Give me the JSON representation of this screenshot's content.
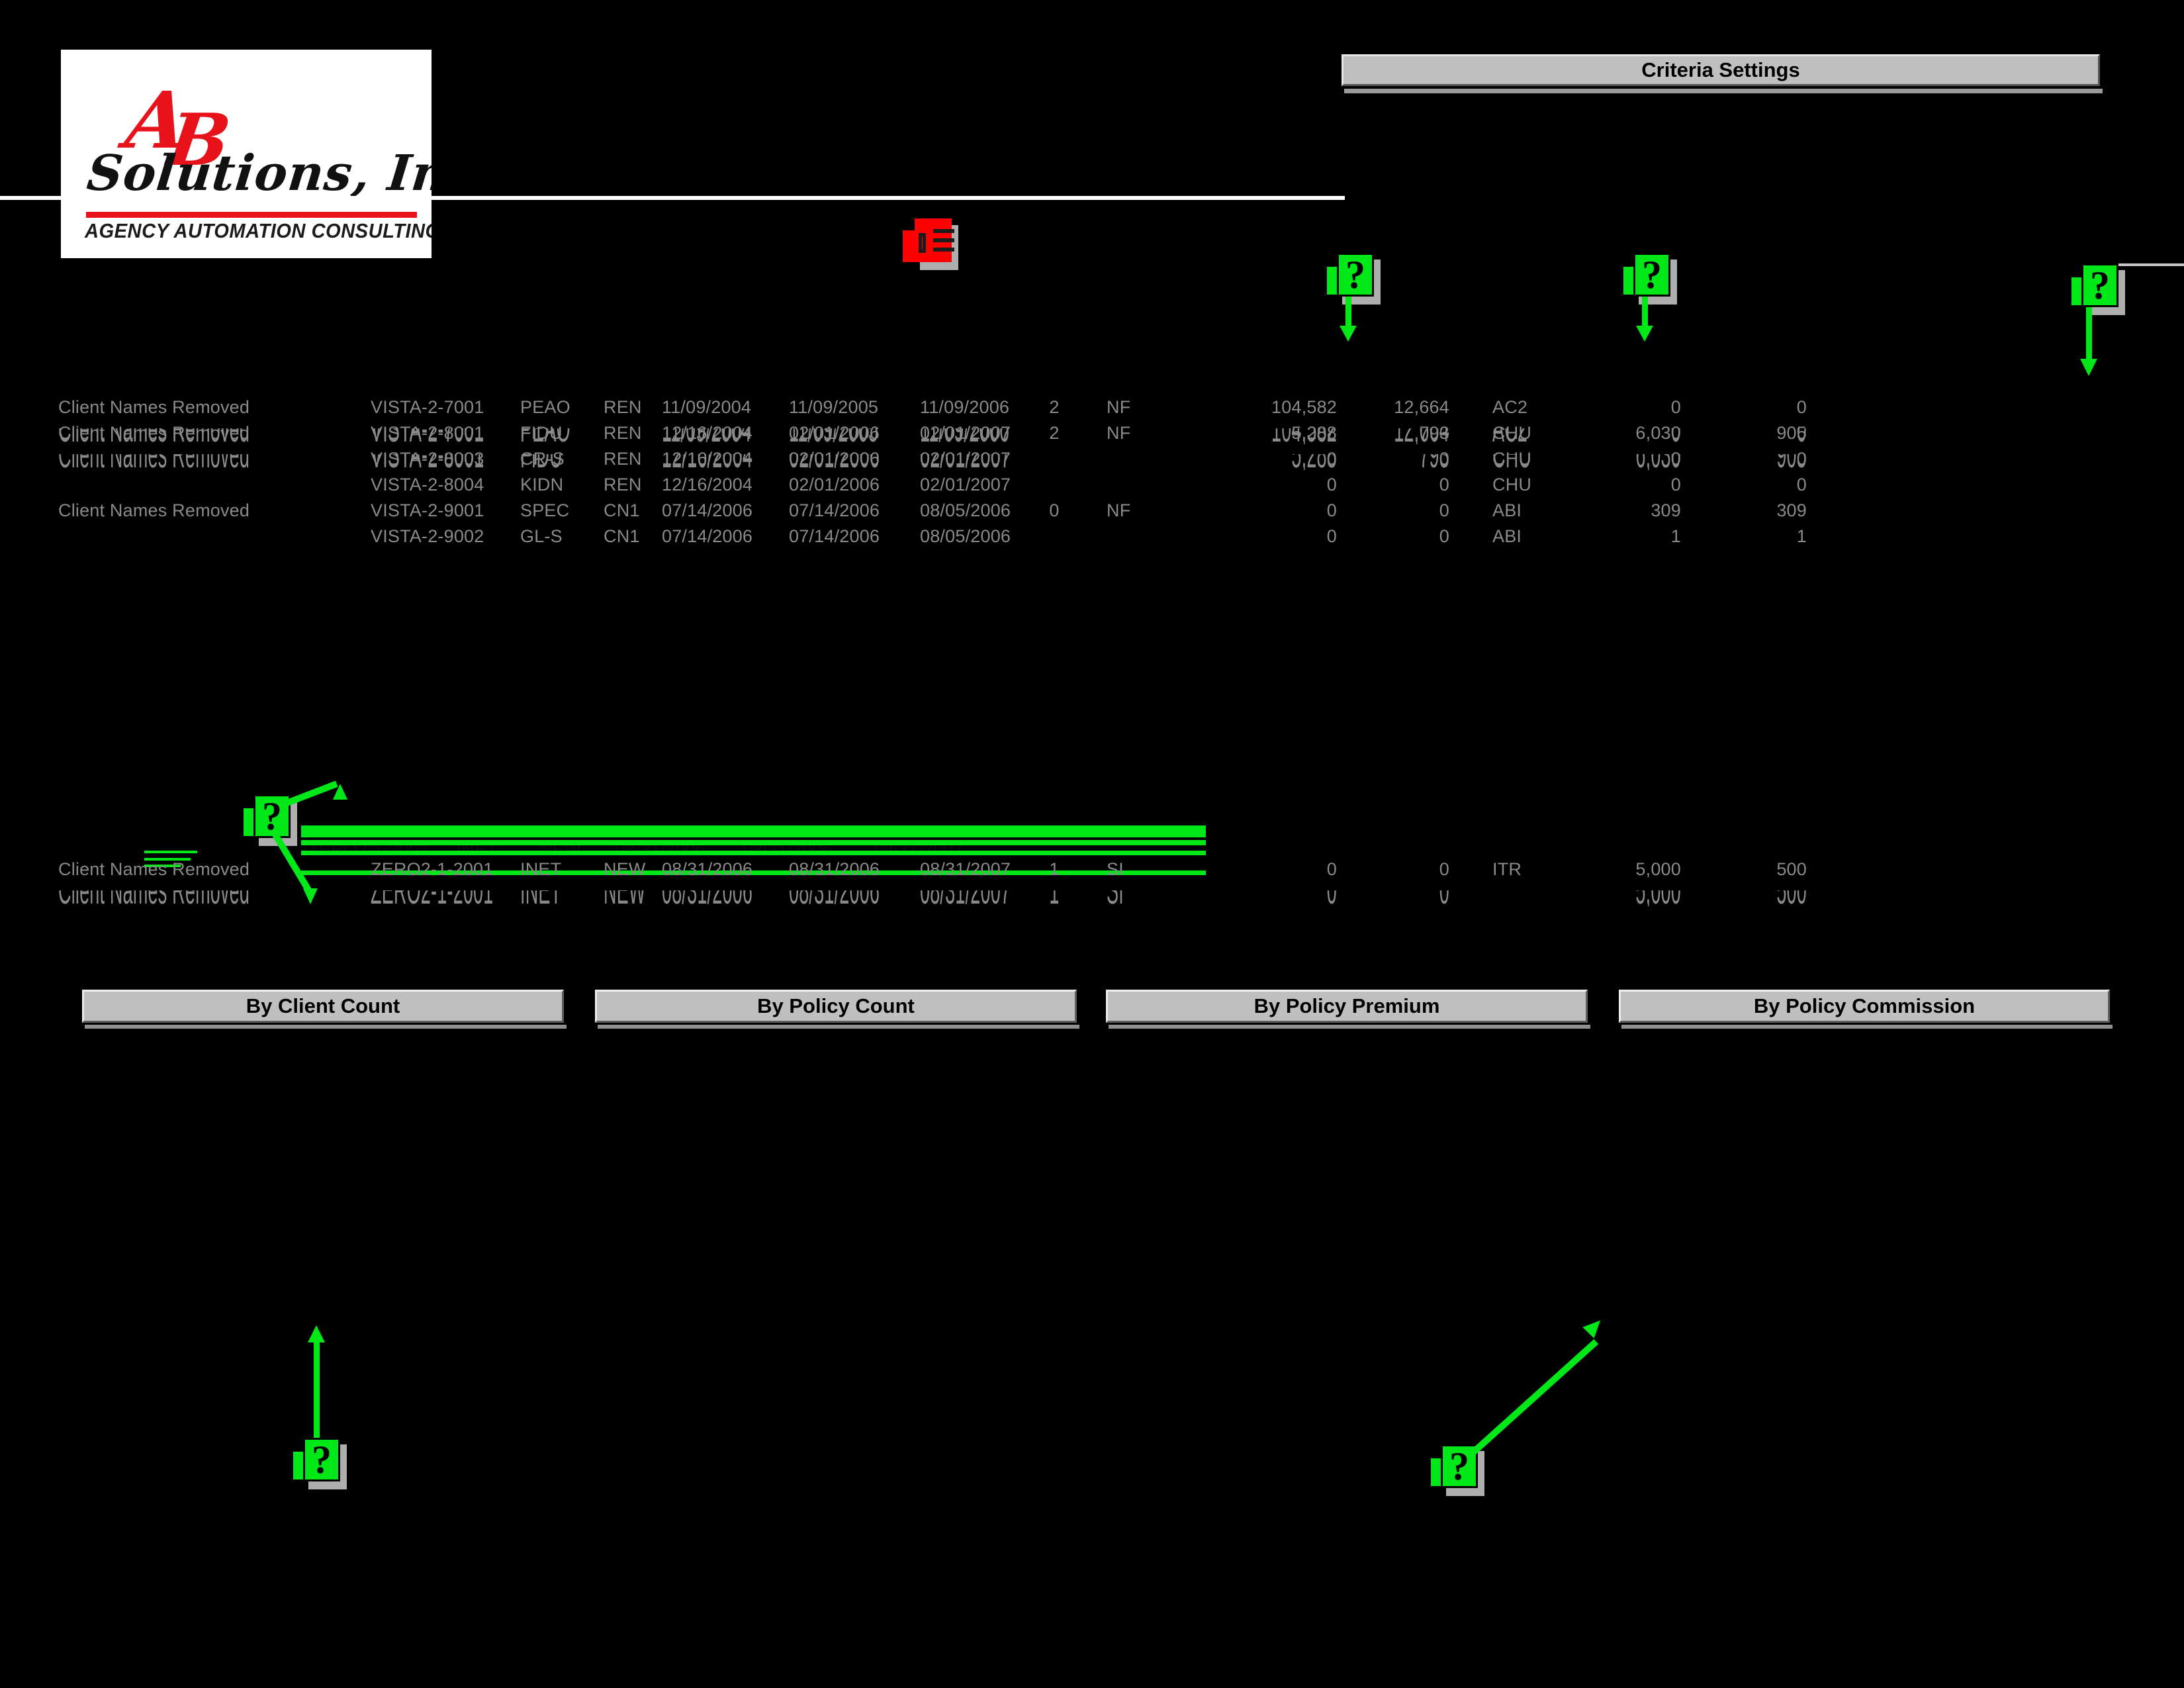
{
  "logo": {
    "initials": "AB",
    "initial_a": "A",
    "initial_b": "B",
    "company": "Solutions, Inc.",
    "tagline": "AGENCY AUTOMATION CONSULTING"
  },
  "header": {
    "criteria_settings_label": "Criteria Settings"
  },
  "table": {
    "rows": [
      {
        "client": "Client Names Removed",
        "policy": "VISTA-2-7001",
        "line": "PEAO",
        "type": "REN",
        "eff_date": "11/09/2004",
        "exp_date": "11/09/2005",
        "renew_date": "11/09/2006",
        "count": "2",
        "status": "NF",
        "premium": "104,582",
        "commission": "12,664",
        "code": "AC2",
        "value1": "0",
        "value2": "0"
      },
      {
        "client": "Client Names Removed",
        "policy": "VISTA-2-8001",
        "line": "FIDU",
        "type": "REN",
        "eff_date": "12/16/2004",
        "exp_date": "02/01/2006",
        "renew_date": "02/01/2007",
        "count": "2",
        "status": "NF",
        "premium": "5,288",
        "commission": "793",
        "code": "CHU",
        "value1": "6,030",
        "value2": "905"
      },
      {
        "client": "",
        "policy": "VISTA-2-8003",
        "line": "CR-S",
        "type": "REN",
        "eff_date": "12/16/2004",
        "exp_date": "02/01/2006",
        "renew_date": "02/01/2007",
        "count": "",
        "status": "",
        "premium": "0",
        "commission": "0",
        "code": "CHU",
        "value1": "0",
        "value2": "0"
      },
      {
        "client": "",
        "policy": "VISTA-2-8004",
        "line": "KIDN",
        "type": "REN",
        "eff_date": "12/16/2004",
        "exp_date": "02/01/2006",
        "renew_date": "02/01/2007",
        "count": "",
        "status": "",
        "premium": "0",
        "commission": "0",
        "code": "CHU",
        "value1": "0",
        "value2": "0"
      },
      {
        "client": "Client Names Removed",
        "policy": "VISTA-2-9001",
        "line": "SPEC",
        "type": "CN1",
        "eff_date": "07/14/2006",
        "exp_date": "07/14/2006",
        "renew_date": "08/05/2006",
        "count": "0",
        "status": "NF",
        "premium": "0",
        "commission": "0",
        "code": "ABI",
        "value1": "309",
        "value2": "309"
      },
      {
        "client": "",
        "policy": "VISTA-2-9002",
        "line": "GL-S",
        "type": "CN1",
        "eff_date": "07/14/2006",
        "exp_date": "07/14/2006",
        "renew_date": "08/05/2006",
        "count": "",
        "status": "",
        "premium": "0",
        "commission": "0",
        "code": "ABI",
        "value1": "1",
        "value2": "1"
      }
    ],
    "zero_row": {
      "client": "Client Names Removed",
      "policy": "ZERO2-1-2001",
      "line": "INET",
      "type": "NEW",
      "eff_date": "08/31/2006",
      "exp_date": "08/31/2006",
      "renew_date": "08/31/2007",
      "count": "1",
      "status": "SI",
      "premium": "0",
      "commission": "0",
      "code": "ITR",
      "value1": "5,000",
      "value2": "500"
    },
    "obscured_row": {
      "policy": "ZERO2-1-2001",
      "line": "INET",
      "type": "NEW",
      "eff_date": "08/31/2006",
      "exp_date": "08/31/2006",
      "renew_date": "08/31/2007"
    }
  },
  "buttons": [
    {
      "label": "By Client Count"
    },
    {
      "label": "By Policy Count"
    },
    {
      "label": "By Policy Premium"
    },
    {
      "label": "By Policy Commission"
    }
  ],
  "callouts": [
    {
      "id": "callout-red-document",
      "glyph": "document-list-icon",
      "color": "#ff0000"
    },
    {
      "id": "callout-help-1",
      "glyph": "?",
      "color": "#00e818"
    },
    {
      "id": "callout-help-2",
      "glyph": "?",
      "color": "#00e818"
    },
    {
      "id": "callout-help-3",
      "glyph": "?",
      "color": "#00e818"
    },
    {
      "id": "callout-help-4",
      "glyph": "?",
      "color": "#00e818"
    },
    {
      "id": "callout-help-5",
      "glyph": "?",
      "color": "#00e818"
    },
    {
      "id": "callout-help-6",
      "glyph": "?",
      "color": "#00e818"
    }
  ],
  "colors": {
    "background": "#000000",
    "text": "#8a8a8a",
    "accent_green": "#00e818",
    "accent_red": "#ff0000",
    "band": "#bfbfbf",
    "logo_red": "#e8131a"
  }
}
